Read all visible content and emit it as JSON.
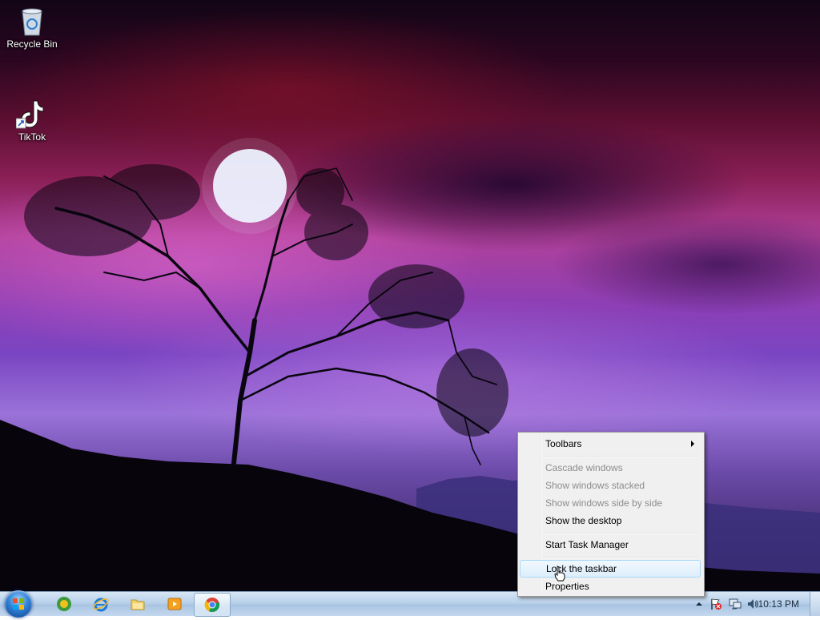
{
  "desktop": {
    "icons": [
      {
        "label": "Recycle Bin",
        "icon": "recycle-bin-icon"
      },
      {
        "label": "TikTok",
        "icon": "tiktok-icon"
      }
    ]
  },
  "taskbar": {
    "start_icon": "windows-logo-icon",
    "pinned": [
      {
        "icon": "windows-media-center-icon"
      },
      {
        "icon": "internet-explorer-icon"
      },
      {
        "icon": "file-explorer-icon"
      },
      {
        "icon": "media-player-icon"
      },
      {
        "icon": "chrome-icon",
        "active": true
      }
    ],
    "tray": {
      "icons": [
        "show-hidden-icons-chevron",
        "action-center-flag-icon",
        "network-icon",
        "volume-icon"
      ],
      "clock": "10:13 PM"
    }
  },
  "context_menu": {
    "items": [
      {
        "label": "Toolbars",
        "submenu": true,
        "enabled": true
      },
      {
        "label": "Cascade windows",
        "enabled": false
      },
      {
        "label": "Show windows stacked",
        "enabled": false
      },
      {
        "label": "Show windows side by side",
        "enabled": false
      },
      {
        "label": "Show the desktop",
        "enabled": true
      },
      {
        "label": "Start Task Manager",
        "enabled": true
      },
      {
        "label": "Lock the taskbar",
        "enabled": true,
        "highlighted": true
      },
      {
        "label": "Properties",
        "enabled": true
      }
    ]
  }
}
